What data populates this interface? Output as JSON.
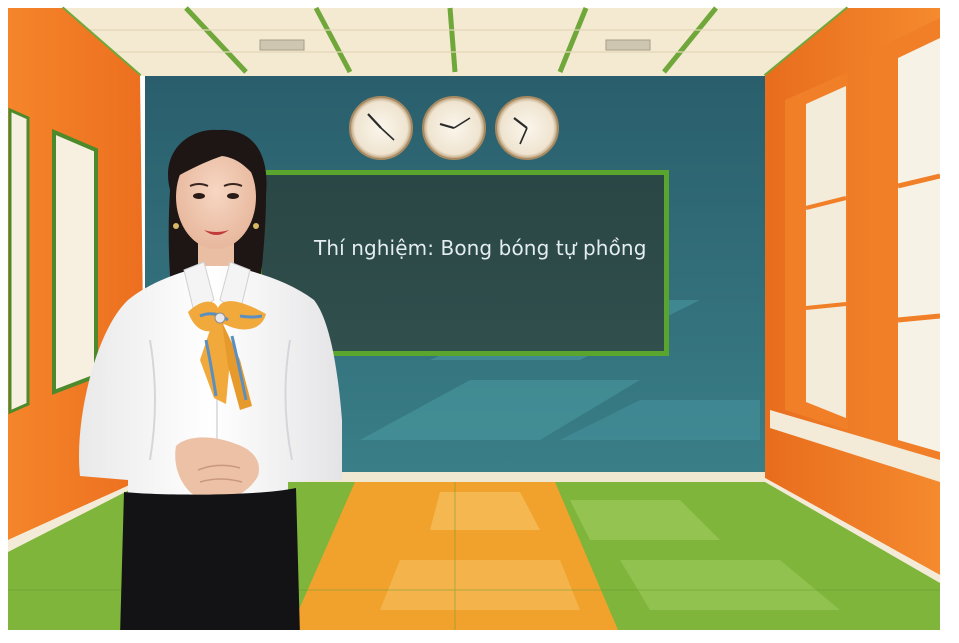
{
  "board": {
    "title": "Thí nghiệm: Bong bóng tự phồng"
  },
  "colors": {
    "wall_orange": "#f07a26",
    "back_wall_teal": "#2f6f7c",
    "chalkboard": "#2d4a4a",
    "board_frame": "#5aa52e",
    "floor_orange": "#f1a22c",
    "floor_green": "#7eb53a",
    "ceiling": "#f4ead2"
  },
  "icons": [
    "wall-clock-icon",
    "wall-clock-icon",
    "wall-clock-icon"
  ]
}
